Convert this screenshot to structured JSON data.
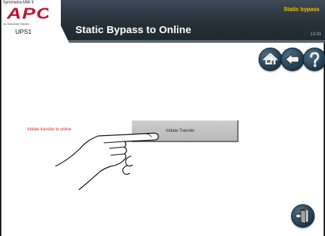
{
  "header": {
    "product_line": "Symmetra MW II",
    "logo_text": "APC",
    "brand_line": "by Schneider Electric",
    "ups_name": "UPS1",
    "title": "Static Bypass to Online",
    "mode": "Static bypass",
    "time": "13:33"
  },
  "colors": {
    "header_bg": "#26313a",
    "title": "#ffffff",
    "mode": "#f7c400",
    "prompt": "#d41a1a",
    "button_bg": "#c4c4c4",
    "nav_button": "#2b4a60",
    "logo": "#c8102e"
  },
  "nav": {
    "home_icon": "home-icon",
    "back_icon": "back-arrow-icon",
    "help_icon": "help-icon",
    "exit_icon": "exit-door-icon"
  },
  "main": {
    "prompt": "Initiate transfer to online",
    "transfer_button": "Initiate Transfer"
  }
}
